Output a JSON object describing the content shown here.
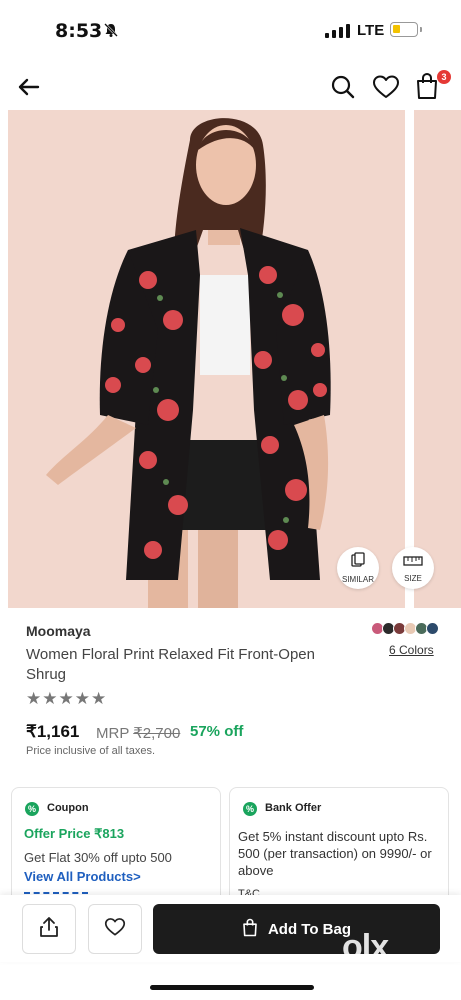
{
  "status": {
    "time": "8:53",
    "network": "LTE"
  },
  "header": {
    "cart_count": "3"
  },
  "image_buttons": {
    "similar": "SIMILAR",
    "size": "SIZE"
  },
  "product": {
    "brand": "Moomaya",
    "title": "Women Floral Print Relaxed Fit Front-Open Shrug",
    "rating_stars": "★★★★★",
    "price": "₹1,161",
    "mrp_label": "MRP",
    "mrp_value": "₹2,700",
    "discount": "57% off",
    "tax_note": "Price inclusive of all taxes.",
    "colors_link": "6 Colors",
    "swatch_colors": [
      "#c95a7a",
      "#2b2b2b",
      "#7a3b3b",
      "#e8c9b4",
      "#4a6b5a",
      "#2c4a6b"
    ]
  },
  "coupon": {
    "title": "Coupon",
    "offer_price": "Offer Price ₹813",
    "flat_off": "Get Flat 30% off upto 500",
    "view_all": "View All Products>"
  },
  "bank_offer": {
    "title": "Bank Offer",
    "text": "Get 5% instant discount upto Rs. 500 (per transaction) on 9990/- or above",
    "tc": "T&C"
  },
  "bottom": {
    "add_to_bag": "Add To Bag"
  },
  "watermark": "olx",
  "colors": {
    "accent_green": "#1aa45d",
    "link_blue": "#1f5fbf",
    "button_dark": "#1c1c1c",
    "badge_red": "#e53935"
  }
}
